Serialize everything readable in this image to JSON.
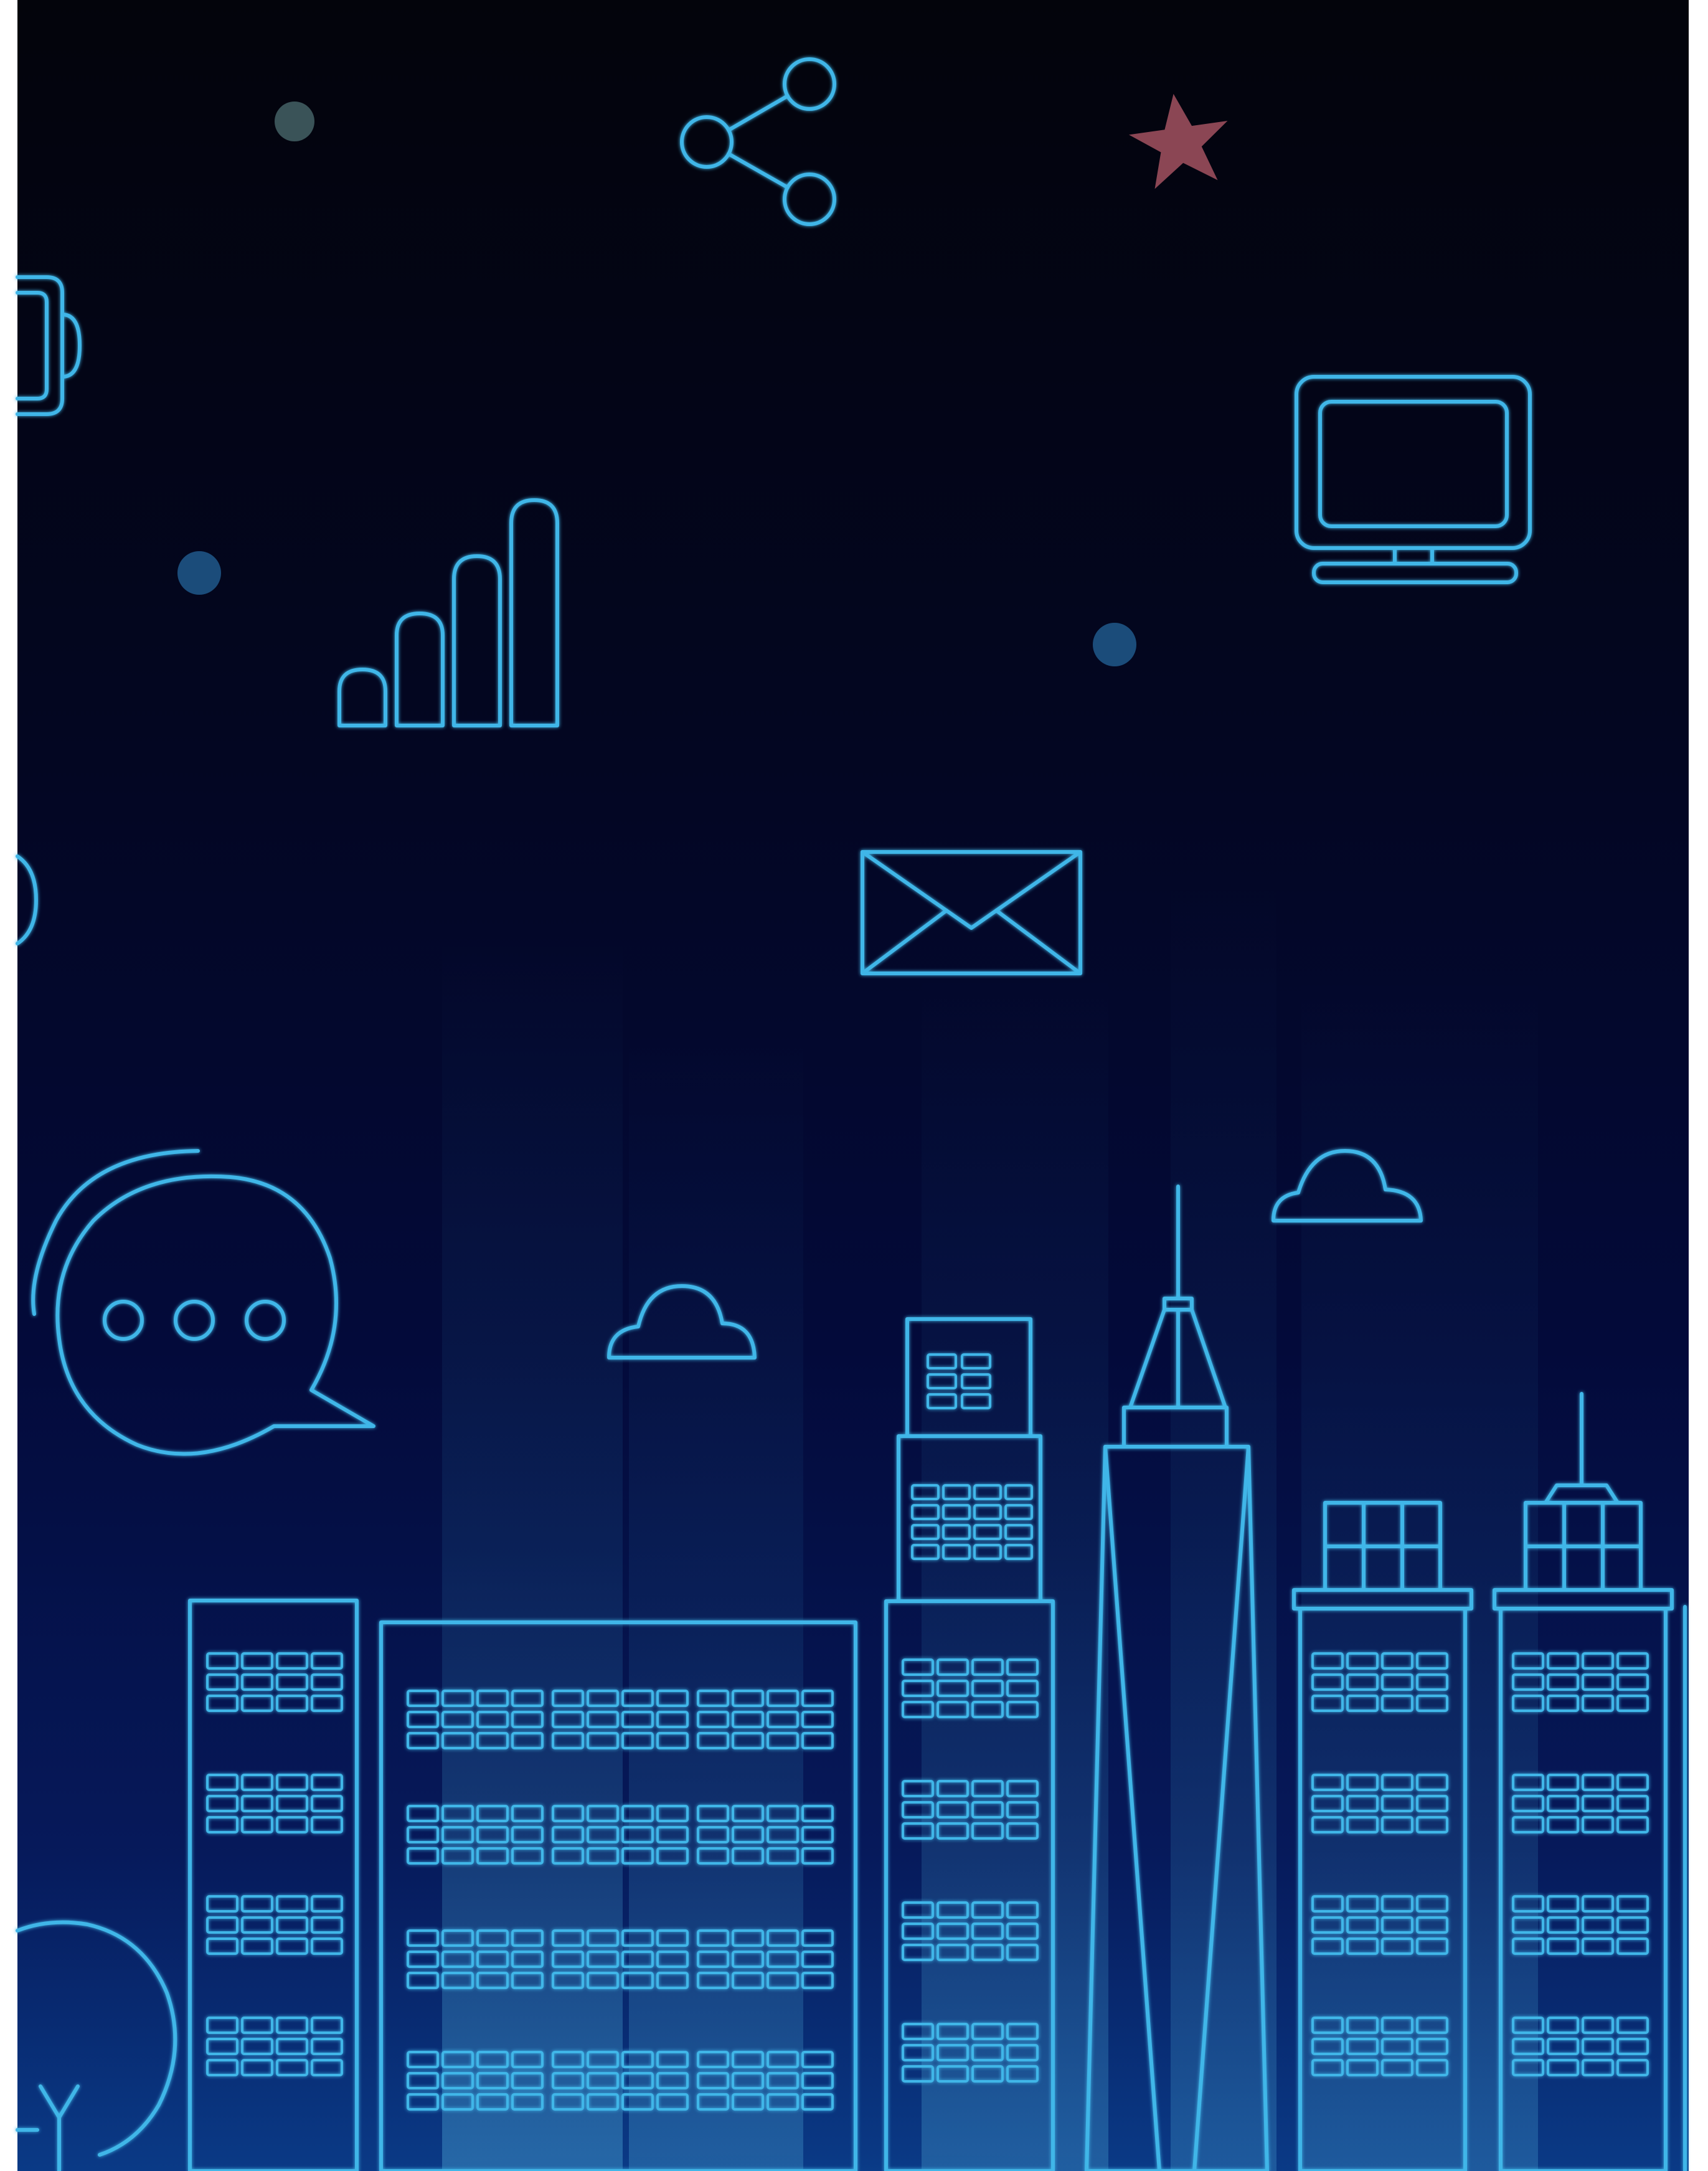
{
  "palette": {
    "sky_top": "#03040c",
    "sky_mid": "#03061f",
    "sky_bottom": "#061a5c",
    "line": "#3fb6e8",
    "line_glow": "#63d2ff",
    "star": "#8b4654",
    "dot_grey": "#3a5358",
    "dot_blue": "#1b4c7a",
    "page_margin": "#ffffff"
  },
  "icons": [
    "share-icon",
    "star-icon",
    "battery-icon",
    "monitor-icon",
    "signal-bars-icon",
    "mail-icon",
    "chat-bubble-icon",
    "cloud-icon",
    "tree-icon"
  ],
  "skyline": {
    "buildings": [
      "tower-left",
      "low-block",
      "stepped-tower",
      "spire-tower",
      "grid-tower",
      "antenna-tower"
    ]
  }
}
